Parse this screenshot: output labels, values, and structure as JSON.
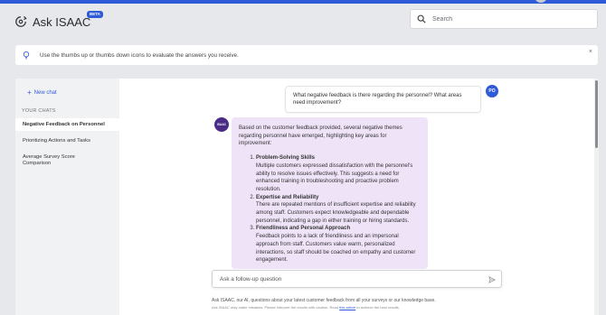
{
  "app": {
    "title": "Ask ISAAC",
    "badge": "BETA",
    "accent_color": "#2f5bd8"
  },
  "search": {
    "placeholder": "Search",
    "icon": "search-icon"
  },
  "tip": {
    "text": "Use the thumbs up or thumbs down icons to evaluate the answers you receive.",
    "close_glyph": "×",
    "icon": "lightbulb-icon"
  },
  "sidebar": {
    "new_chat_icon": "+",
    "new_chat_label": "New chat",
    "section_label": "YOUR CHATS",
    "chats": [
      {
        "label": "Negative Feedback on Personnel",
        "active": true
      },
      {
        "label": "Prioritizing Actions and Tasks",
        "active": false
      },
      {
        "label": "Average Survey Score Comparison",
        "active": false
      }
    ]
  },
  "conversation": {
    "user_initials": "PO",
    "user_message": "What negative feedback is there regarding the personnel? What areas need improvement?",
    "bot_avatar_label": "ISAAC",
    "bot_intro": "Based on the customer feedback provided, several negative themes regarding personnel have emerged, highlighting key areas for improvement:",
    "bot_points": [
      {
        "heading": "Problem-Solving Skills",
        "body": "Multiple customers expressed dissatisfaction with the personnel's ability to resolve issues effectively. This suggests a need for enhanced training in troubleshooting and proactive problem resolution."
      },
      {
        "heading": "Expertise and Reliability",
        "body": "There are repeated mentions of insufficient expertise and reliability among staff. Customers expect knowledgeable and dependable personnel, indicating a gap in either training or hiring standards."
      },
      {
        "heading": "Friendliness and Personal Approach",
        "body": "Feedback points to a lack of friendliness and an impersonal approach from staff. Customers value warm, personalized interactions, so staff should be coached on empathy and customer engagement."
      }
    ]
  },
  "composer": {
    "placeholder": "Ask a follow-up question",
    "send_icon": "send-icon"
  },
  "footer": {
    "disclaimer": "Ask ISAAC, our AI, questions about your latest customer feedback from all your surveys or our knowledge base.",
    "fineprint_before": "Ask ISAAC may make mistakes. Please interpret the results with caution. Read",
    "fineprint_link": "this article",
    "fineprint_after": "to achieve the best results."
  }
}
